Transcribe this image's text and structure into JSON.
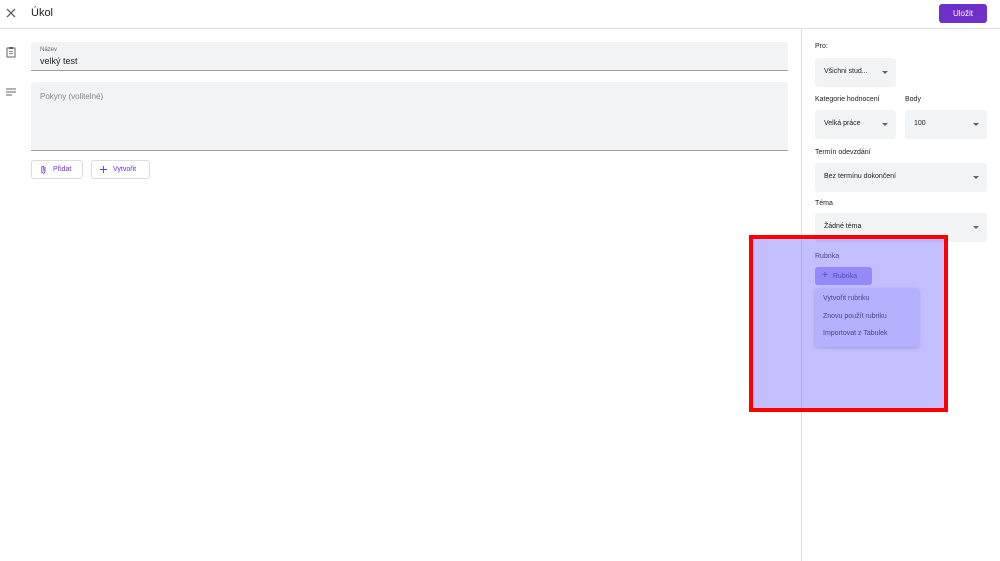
{
  "header": {
    "title": "Úkol",
    "save_label": "Uložit",
    "close_icon": "close-icon"
  },
  "main": {
    "title_field": {
      "label": "Název",
      "value": "velký test"
    },
    "instructions_field": {
      "placeholder": "Pokyny (volitelné)"
    },
    "attach_label": "Přidat",
    "create_label": "Vytvořit"
  },
  "side": {
    "for_label": "Pro:",
    "for_value": "Všichni stud...",
    "grade_category_label": "Kategorie hodnocení",
    "grade_category_value": "Velká práce",
    "points_label": "Body",
    "points_value": "100",
    "due_label": "Termín odevzdání",
    "due_value": "Bez termínu dokončení",
    "topic_label": "Téma",
    "topic_value": "Žádné téma",
    "rubric_label": "Rubrika",
    "rubric_button_label": "Rubrika",
    "rubric_menu": [
      "Vytvořit rubriku",
      "Znovu použít rubriku",
      "Importovat z Tabulek"
    ]
  },
  "colors": {
    "accent": "#6f2fcb",
    "highlight_border": "#ff0000",
    "highlight_fill": "#786eff"
  }
}
